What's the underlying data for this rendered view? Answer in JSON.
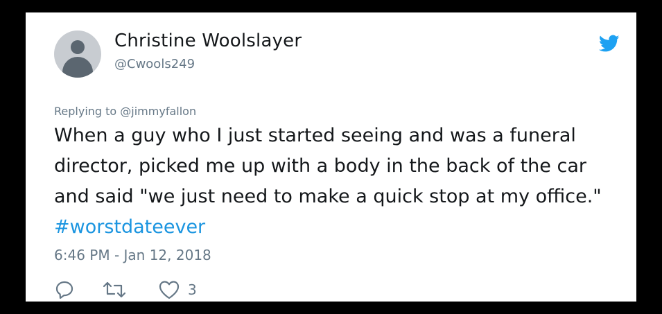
{
  "tweet": {
    "author_name": "Christine Woolslayer",
    "author_handle": "@Cwools249",
    "replying_to": "Replying to @jimmyfallon",
    "text": "When a guy who I just started seeing and was a funeral director, picked me up with a body in the back of the car and said \"we just need to make a quick stop at my office.\" ",
    "hashtag": "#worstdateever",
    "timestamp": "6:46 PM - Jan 12, 2018",
    "like_count": "3"
  },
  "icons": {
    "brand": "twitter-bird-icon",
    "reply": "reply-icon",
    "retweet": "retweet-icon",
    "like": "heart-icon"
  },
  "colors": {
    "brand_blue": "#1da1f2",
    "hashtag_blue": "#1b95e0",
    "text": "#14171a",
    "secondary": "#657786"
  }
}
